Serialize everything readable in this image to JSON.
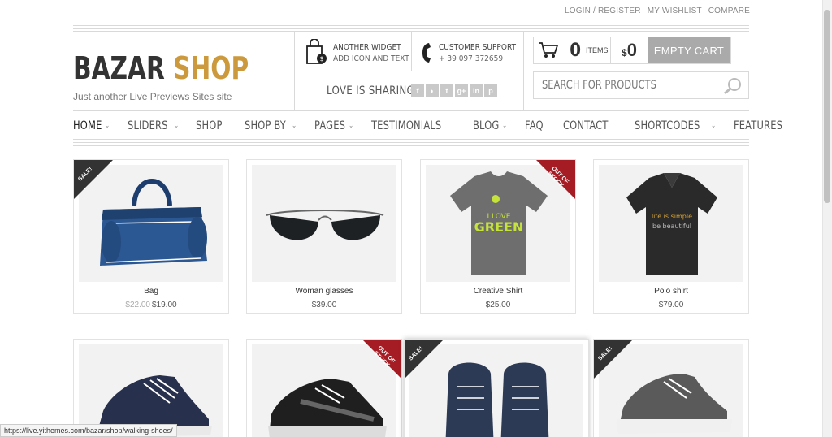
{
  "topbar": {
    "login": "LOGIN / REGISTER",
    "wishlist": "MY WISHLIST",
    "compare": "COMPARE"
  },
  "brand": {
    "part1": "BAZAR",
    "part2": "SHOP",
    "tagline": "Just another Live Previews Sites site",
    "accent_color": "#cc9a3c"
  },
  "widget1": {
    "title": "ANOTHER WIDGET",
    "subtitle": "ADD ICON AND TEXT",
    "icon": "shopping-bag-icon"
  },
  "widget2": {
    "title": "CUSTOMER SUPPORT",
    "subtitle": "+ 39 097 372659",
    "icon": "phone-icon"
  },
  "sharing": {
    "label": "LOVE IS SHARING",
    "icons": [
      "f",
      "rss",
      "t",
      "g+",
      "in",
      "p"
    ]
  },
  "cart": {
    "count": "0",
    "items_label": "ITEMS",
    "currency": "$",
    "total": "0",
    "button": "EMPTY CART"
  },
  "search": {
    "placeholder": "SEARCH FOR PRODUCTS"
  },
  "nav": [
    {
      "label": "HOME",
      "has_dropdown": true
    },
    {
      "label": "SLIDERS",
      "has_dropdown": true
    },
    {
      "label": "SHOP",
      "has_dropdown": false
    },
    {
      "label": "SHOP BY",
      "has_dropdown": true
    },
    {
      "label": "PAGES",
      "has_dropdown": true
    },
    {
      "label": "TESTIMONIALS",
      "has_dropdown": false
    },
    {
      "label": "BLOG",
      "has_dropdown": true
    },
    {
      "label": "FAQ",
      "has_dropdown": false
    },
    {
      "label": "CONTACT",
      "has_dropdown": false
    },
    {
      "label": "SHORTCODES",
      "has_dropdown": true
    },
    {
      "label": "FEATURES",
      "has_dropdown": false
    }
  ],
  "products": [
    {
      "name": "Bag",
      "old_price": "$22.00",
      "price": "$19.00",
      "badge": "SALE!"
    },
    {
      "name": "Woman glasses",
      "old_price": "",
      "price": "$39.00",
      "badge": ""
    },
    {
      "name": "Creative Shirt",
      "old_price": "",
      "price": "$25.00",
      "badge": "OUT OF STOCK"
    },
    {
      "name": "Polo shirt",
      "old_price": "",
      "price": "$79.00",
      "badge": ""
    },
    {
      "name": "",
      "old_price": "",
      "price": "",
      "badge": ""
    },
    {
      "name": "",
      "old_price": "",
      "price": "",
      "badge": "OUT OF STOCK"
    },
    {
      "name": "",
      "old_price": "",
      "price": "",
      "badge": "SALE!"
    },
    {
      "name": "",
      "old_price": "",
      "price": "",
      "badge": "SALE!"
    }
  ],
  "tshirt_print": {
    "line1": "I LOVE",
    "line2": "GREEN"
  },
  "polo_print": {
    "line1": "life is simple",
    "line2": "be beautiful"
  },
  "statusbar": {
    "url": "https://live.yithemes.com/bazar/shop/walking-shoes/"
  }
}
